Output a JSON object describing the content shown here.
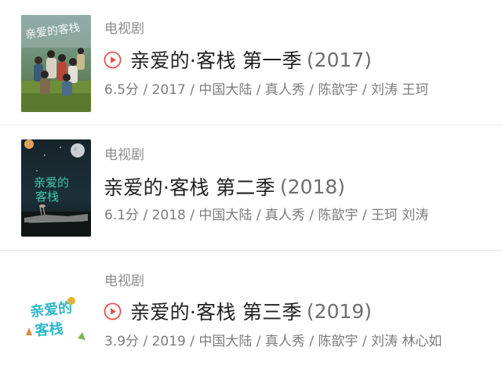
{
  "results": [
    {
      "category": "电视剧",
      "title": "亲爱的·客栈 第一季",
      "year": "(2017)",
      "meta": "6.5分 / 2017 / 中国大陆 / 真人秀 / 陈歆宇 / 刘涛 王珂",
      "has_play": true,
      "poster_text": "亲爱的客栈"
    },
    {
      "category": "电视剧",
      "title": "亲爱的·客栈 第二季",
      "year": "(2018)",
      "meta": "6.1分 / 2018 / 中国大陆 / 真人秀 / 陈歆宇 / 王珂 刘涛",
      "has_play": false,
      "poster_text": "亲爱的客栈"
    },
    {
      "category": "电视剧",
      "title": "亲爱的·客栈 第三季",
      "year": "(2019)",
      "meta": "3.9分 / 2019 / 中国大陆 / 真人秀 / 陈歆宇 / 刘涛 林心如",
      "has_play": true,
      "poster_text": "亲爱的客栈"
    }
  ],
  "colors": {
    "play_accent": "#e84b46",
    "category_text": "#8c8c8c",
    "title_text": "#222222",
    "meta_text": "#7d7d7d",
    "divider": "#e8e8e8"
  },
  "icons": {
    "play": "play-circle-icon"
  }
}
